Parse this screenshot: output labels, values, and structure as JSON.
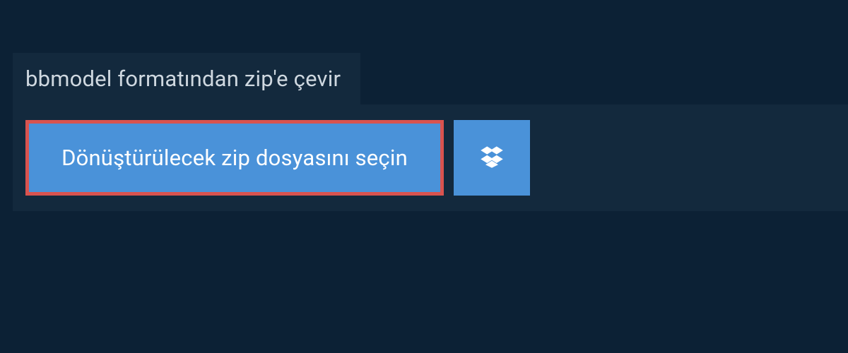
{
  "header": {
    "title": "bbmodel formatından zip'e çevir"
  },
  "actions": {
    "select_label": "Dönüştürülecek zip dosyasını seçin"
  },
  "colors": {
    "page_bg": "#0c2135",
    "panel_bg": "#13293d",
    "button_bg": "#4a92d9",
    "highlight_border": "#d9534f",
    "text_light": "#ffffff",
    "text_muted": "#cfd8e0"
  }
}
